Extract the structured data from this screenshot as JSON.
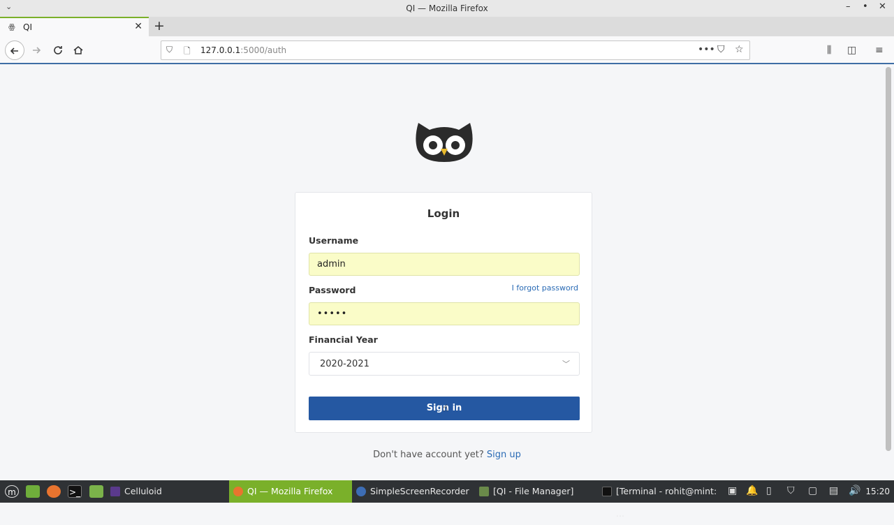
{
  "window": {
    "title": "QI — Mozilla Firefox",
    "min": "–",
    "restore": "•",
    "close": "✕"
  },
  "tab": {
    "title": "QI",
    "close": "✕",
    "new": "+"
  },
  "url": {
    "host": "127.0.0.1",
    "rest": ":5000/auth"
  },
  "login": {
    "title": "Login",
    "username_label": "Username",
    "username_value": "admin",
    "password_label": "Password",
    "password_value": "•••••",
    "forgot": "I forgot password",
    "fy_label": "Financial Year",
    "fy_value": "2020-2021",
    "signin": "Sign in",
    "footer_prefix": "Don't have account yet?",
    "footer_link": "Sign up"
  },
  "taskbar": {
    "items": [
      {
        "label": "Celluloid"
      },
      {
        "label": "QI — Mozilla Firefox"
      },
      {
        "label": "SimpleScreenRecorder"
      },
      {
        "label": "[QI - File Manager]"
      },
      {
        "label": "[Terminal - rohit@mint: ..."
      }
    ],
    "clock": "15:20"
  },
  "colors": {
    "accent": "#7ab02a",
    "primary_button": "#2558a2",
    "link": "#2a6bb5",
    "autofill": "#fafcc8"
  }
}
